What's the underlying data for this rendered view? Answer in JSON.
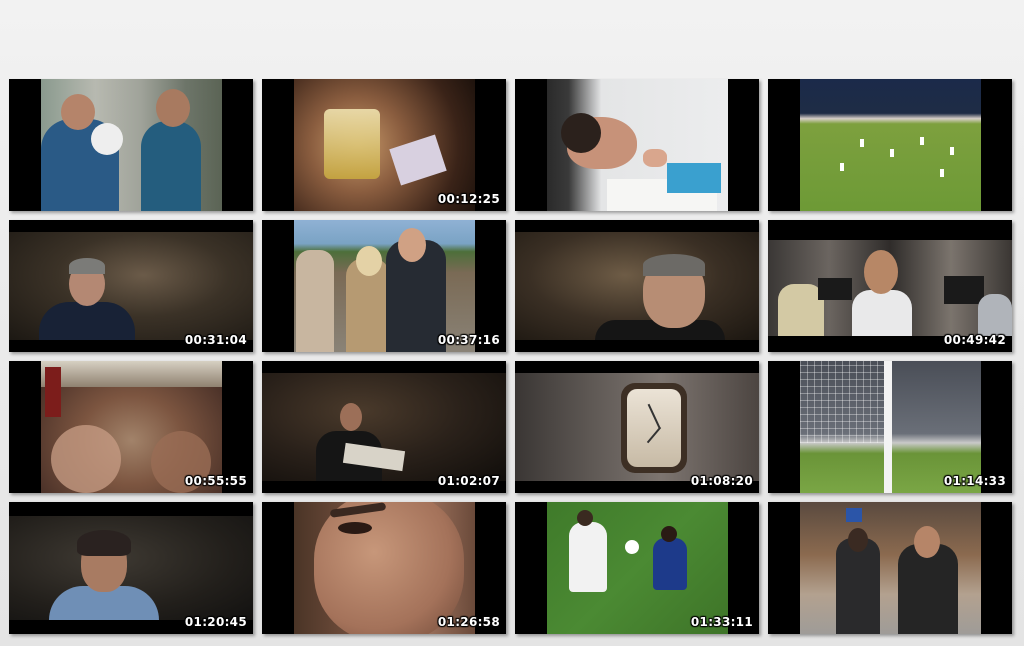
{
  "thumbnails": [
    {
      "timestamp": ""
    },
    {
      "timestamp": "00:12:25"
    },
    {
      "timestamp": ""
    },
    {
      "timestamp": ""
    },
    {
      "timestamp": "00:31:04"
    },
    {
      "timestamp": "00:37:16"
    },
    {
      "timestamp": ""
    },
    {
      "timestamp": "00:49:42"
    },
    {
      "timestamp": "00:55:55"
    },
    {
      "timestamp": "01:02:07"
    },
    {
      "timestamp": "01:08:20"
    },
    {
      "timestamp": "01:14:33"
    },
    {
      "timestamp": "01:20:45"
    },
    {
      "timestamp": "01:26:58"
    },
    {
      "timestamp": "01:33:11"
    },
    {
      "timestamp": ""
    }
  ]
}
